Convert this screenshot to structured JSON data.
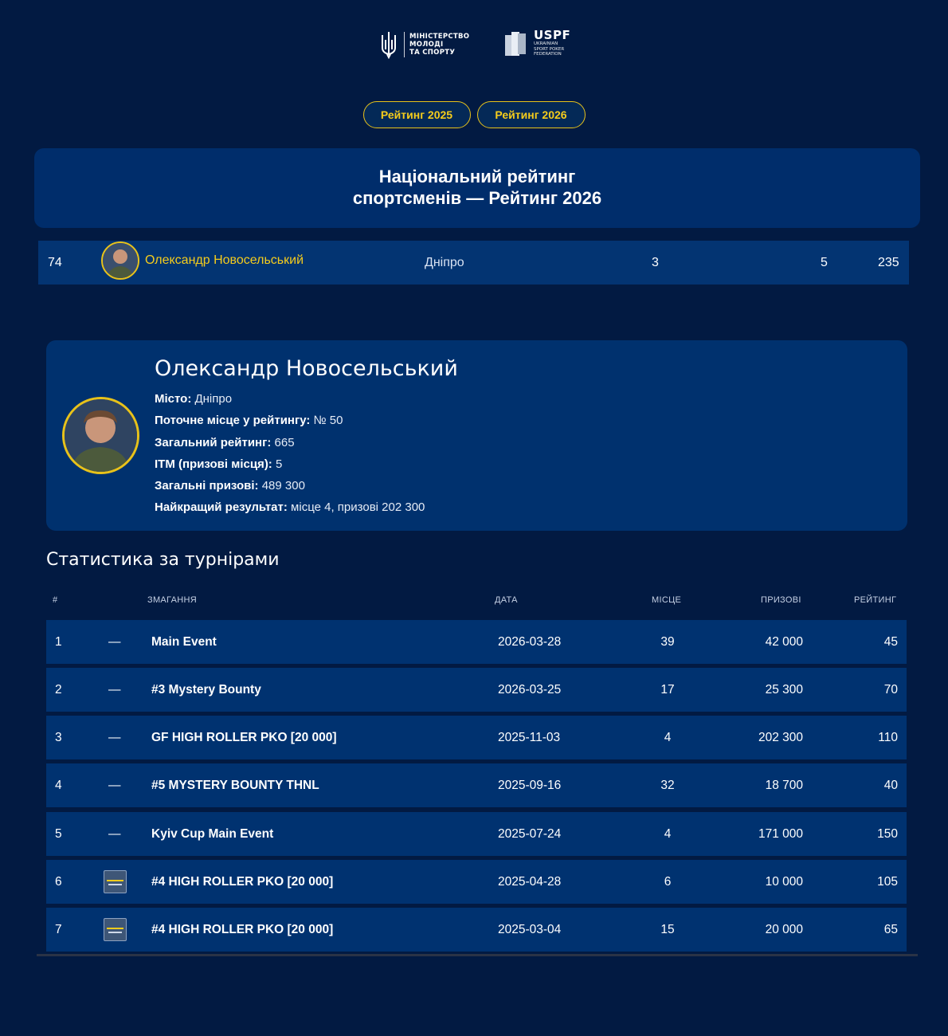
{
  "header": {
    "ministry_lines": [
      "МІНІСТЕРСТВО",
      "МОЛОДІ",
      "ТА СПОРТУ"
    ],
    "uspf_title": "USPF",
    "uspf_lines": [
      "UKRAINIAN",
      "SPORT POKER",
      "FEDERATION"
    ]
  },
  "year_tabs": [
    {
      "label": "Рейтинг 2025"
    },
    {
      "label": "Рейтинг 2026"
    }
  ],
  "banner": {
    "line1": "Національний рейтинг",
    "line2": "спортсменів — Рейтинг 2026"
  },
  "rank_row": {
    "position": "74",
    "name": "Олександр Новосельський",
    "city": "Дніпро",
    "value1": "3",
    "value2": "5",
    "value3": "235"
  },
  "profile": {
    "name": "Олександр Новосельський",
    "facts": [
      {
        "label": "Місто:",
        "value": "Дніпро"
      },
      {
        "label": "Поточне місце у рейтингу:",
        "value": "№ 50"
      },
      {
        "label": "Загальний рейтинг:",
        "value": "665"
      },
      {
        "label": "ITM (призові місця):",
        "value": "5"
      },
      {
        "label": "Загальні призові:",
        "value": "489 300"
      },
      {
        "label": "Найкращий результат:",
        "value": "місце 4, призові 202 300"
      }
    ]
  },
  "stats": {
    "title": "Статистика за турнірами",
    "columns": {
      "num": "#",
      "event": "ЗМАГАННЯ",
      "date": "ДАТА",
      "place": "МІСЦЕ",
      "prize": "ПРИЗОВІ",
      "rating": "РЕЙТИНГ"
    },
    "rows": [
      {
        "num": "1",
        "logo": "—",
        "event": "Main Event",
        "date": "2026-03-28",
        "place": "39",
        "prize": "42 000",
        "rating": "45"
      },
      {
        "num": "2",
        "logo": "—",
        "event": "#3 Mystery Bounty",
        "date": "2026-03-25",
        "place": "17",
        "prize": "25 300",
        "rating": "70"
      },
      {
        "num": "3",
        "logo": "—",
        "event": "GF HIGH ROLLER PKO [20 000]",
        "date": "2025-11-03",
        "place": "4",
        "prize": "202 300",
        "rating": "110"
      },
      {
        "num": "4",
        "logo": "—",
        "event": "#5 MYSTERY BOUNTY THNL",
        "date": "2025-09-16",
        "place": "32",
        "prize": "18 700",
        "rating": "40"
      },
      {
        "num": "5",
        "logo": "—",
        "event": "Kyiv Cup Main Event",
        "date": "2025-07-24",
        "place": "4",
        "prize": "171 000",
        "rating": "150"
      },
      {
        "num": "6",
        "logo": "",
        "event": "#4 HIGH ROLLER PKO [20 000]",
        "date": "2025-04-28",
        "place": "6",
        "prize": "10 000",
        "rating": "105"
      },
      {
        "num": "7",
        "logo": "",
        "event": "#4 HIGH ROLLER PKO [20 000]",
        "date": "2025-03-04",
        "place": "15",
        "prize": "20 000",
        "rating": "65"
      }
    ]
  },
  "colors": {
    "background": "#021a42",
    "card": "#00316e",
    "accent": "#f5cc1c"
  }
}
